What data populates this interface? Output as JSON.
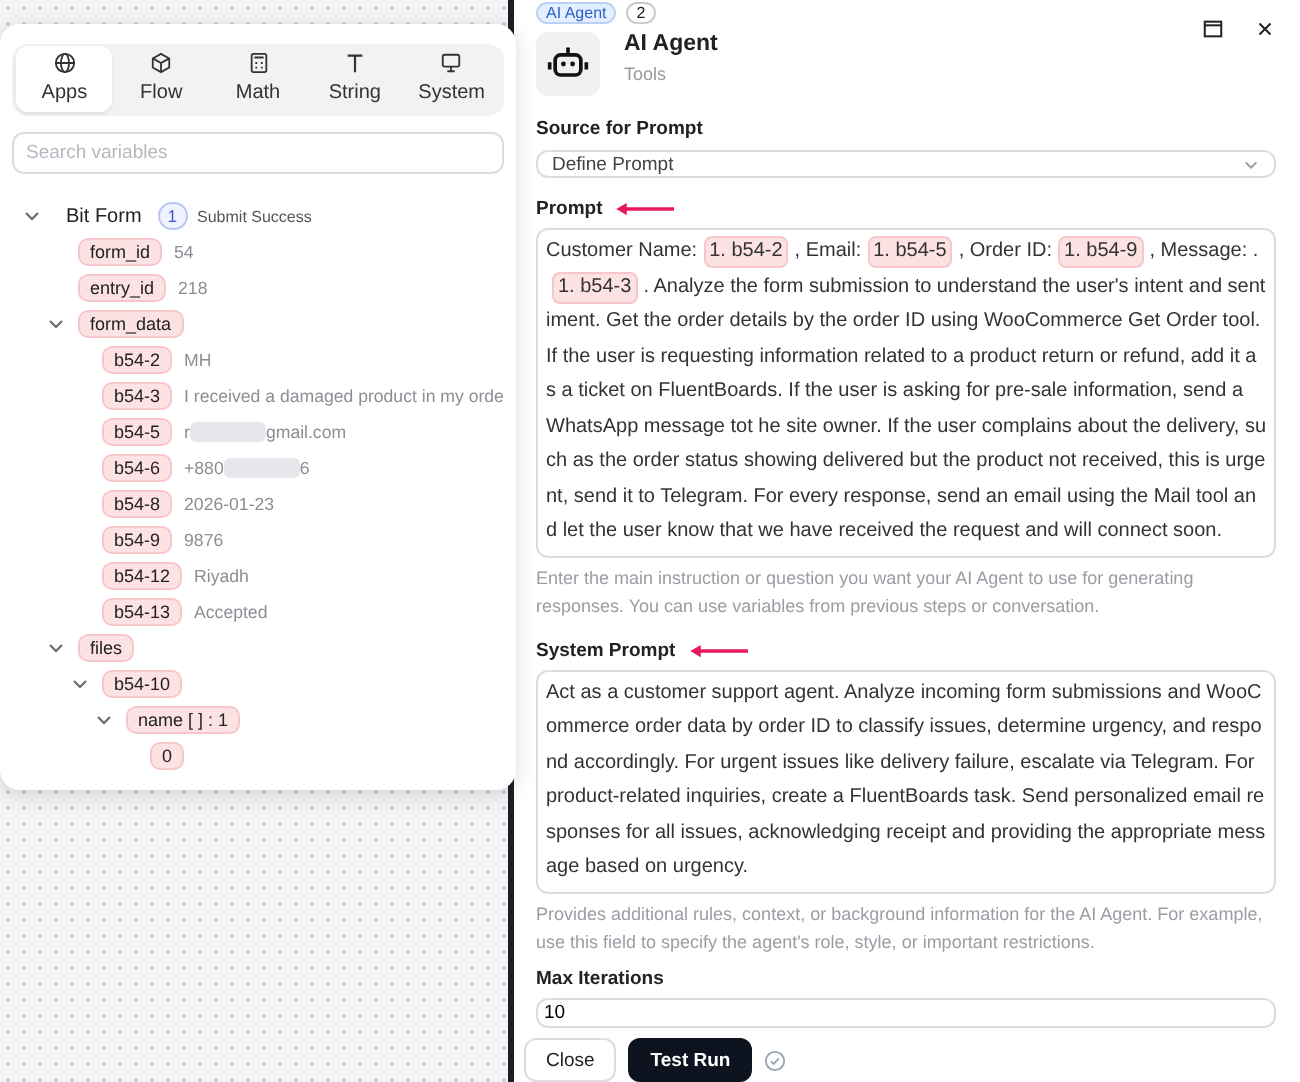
{
  "variables_panel": {
    "tabs": [
      {
        "label": "Apps",
        "selected": true
      },
      {
        "label": "Flow",
        "selected": false
      },
      {
        "label": "Math",
        "selected": false
      },
      {
        "label": "String",
        "selected": false
      },
      {
        "label": "System",
        "selected": false
      }
    ],
    "search": {
      "placeholder": "Search variables"
    },
    "tree": [
      {
        "kind": "app",
        "label": "Bit Form",
        "badge": "1",
        "note": "Submit Success",
        "expanded": true,
        "children": [
          {
            "kind": "var",
            "label": "form_id",
            "value": "54"
          },
          {
            "kind": "var",
            "label": "entry_id",
            "value": "218"
          },
          {
            "kind": "var",
            "label": "form_data",
            "expanded": true,
            "children": [
              {
                "kind": "var",
                "label": "b54-2",
                "value": "MH"
              },
              {
                "kind": "var",
                "label": "b54-3",
                "value": "I received a damaged product in my orde"
              },
              {
                "kind": "var",
                "label": "b54-5",
                "value": "r",
                "masked": true,
                "value_end": "gmail.com"
              },
              {
                "kind": "var",
                "label": "b54-6",
                "value": "+880",
                "masked": true,
                "value_end": "6"
              },
              {
                "kind": "var",
                "label": "b54-8",
                "value": "2026-01-23"
              },
              {
                "kind": "var",
                "label": "b54-9",
                "value": "9876"
              },
              {
                "kind": "var",
                "label": "b54-12",
                "value": "Riyadh"
              },
              {
                "kind": "var",
                "label": "b54-13",
                "value": "Accepted"
              }
            ]
          },
          {
            "kind": "var",
            "label": "files",
            "expanded": true,
            "children": [
              {
                "kind": "var",
                "label": "b54-10",
                "expanded": true,
                "children": [
                  {
                    "kind": "var",
                    "label": "name [ ] : 1",
                    "expanded": true,
                    "children": [
                      {
                        "kind": "var",
                        "label": "0"
                      }
                    ]
                  }
                ]
              }
            ]
          }
        ]
      }
    ]
  },
  "node_panel": {
    "node_tag": "AI Agent",
    "node_count": "2",
    "title": "AI Agent",
    "subtitle": "Tools",
    "source": {
      "label": "Source for Prompt",
      "value": "Define Prompt"
    },
    "prompt": {
      "label": "Prompt",
      "marked": true,
      "segments": [
        {
          "kind": "text",
          "text": "Customer Name:"
        },
        {
          "kind": "chip",
          "text": "1. b54-2"
        },
        {
          "kind": "text",
          "text": ", Email:"
        },
        {
          "kind": "chip",
          "text": "1. b54-5"
        },
        {
          "kind": "text",
          "text": ", Order ID:"
        },
        {
          "kind": "chip",
          "text": "1. b54-9"
        },
        {
          "kind": "text",
          "text": ", Message: ."
        },
        {
          "kind": "chip",
          "text": "1. b54-3"
        },
        {
          "kind": "text",
          "text": ". Analyze the form submission to understand the user's intent and sentiment. Get the order details by the order ID using WooCommerce Get Order tool. If the user is requesting information related to a product return or refund, add it as a ticket on FluentBoards. If the user is asking for pre-sale information, send a WhatsApp message tot he site owner. If the user complains about the delivery, such as the order status showing delivered but the product not received, this is urgent, send it to Telegram. For every response, send an email using the Mail tool and let the user know that we have received the request and will connect soon."
        }
      ],
      "help": "Enter the main instruction or question you want your AI Agent to use for generating responses. You can use variables from previous steps or conversation."
    },
    "system_prompt": {
      "label": "System Prompt",
      "marked": true,
      "text": "Act as a customer support agent. Analyze incoming form submissions and WooCommerce order data by order ID to classify issues, determine urgency, and respond accordingly. For urgent issues like delivery failure, escalate via Telegram. For product-related inquiries, create a FluentBoards task. Send personalized email responses for all issues, acknowledging receipt and providing the appropriate message based on urgency.",
      "help": "Provides additional rules, context, or background information for the AI Agent. For example, use this field to specify the agent's role, style, or important restrictions."
    },
    "max_iterations": {
      "label": "Max Iterations",
      "value": "10"
    },
    "buttons": [
      {
        "kind": "secondary",
        "label": "Close"
      },
      {
        "kind": "primary",
        "label": "Test Run"
      }
    ]
  }
}
